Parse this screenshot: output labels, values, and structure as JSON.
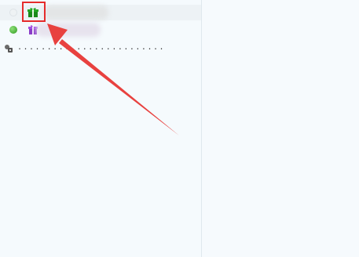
{
  "contacts": [
    {
      "status": "offline",
      "icon": "green-gift-icon"
    },
    {
      "status": "online",
      "icon": "purple-gift-icon"
    }
  ],
  "group_row": {
    "icon": "lock-icon",
    "dots": "........................."
  },
  "annotation": {
    "color": "#e52c2c",
    "type": "arrow-callout"
  }
}
